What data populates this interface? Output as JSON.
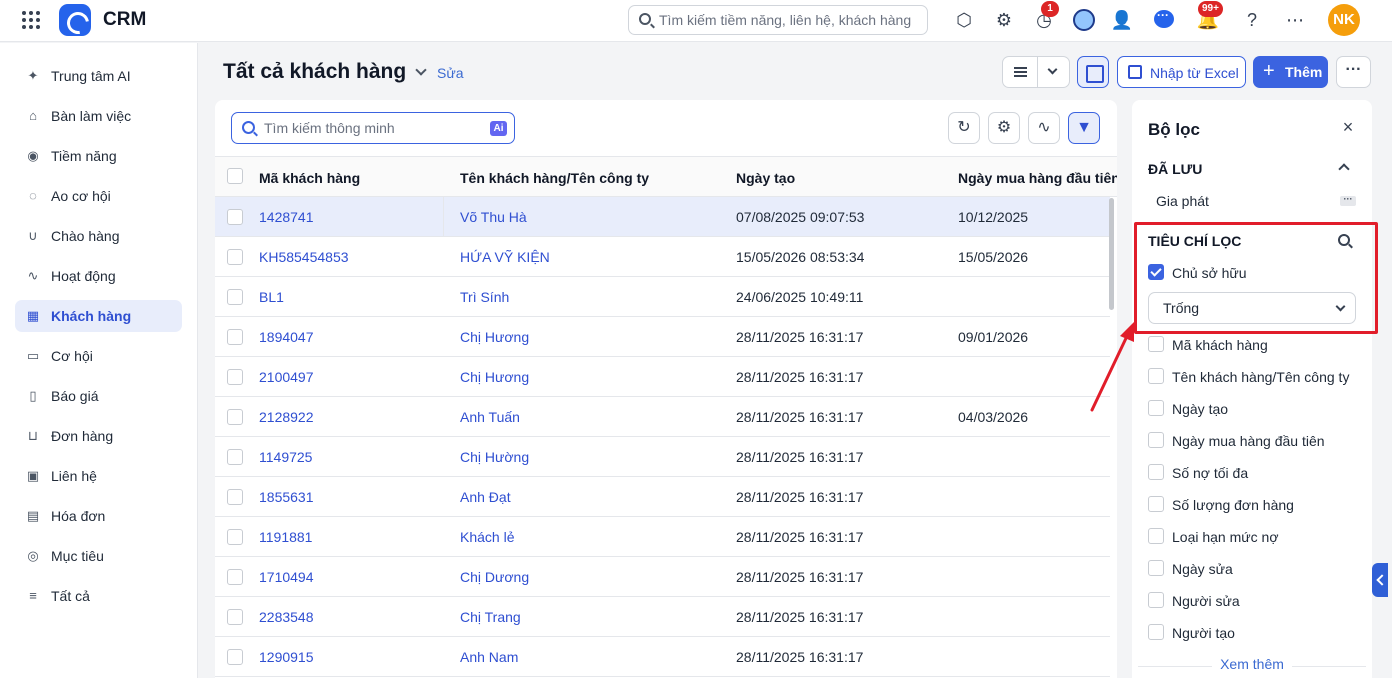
{
  "app": {
    "title": "CRM"
  },
  "search": {
    "placeholder": "Tìm kiếm tiềm năng, liên hệ, khách hàng"
  },
  "topbar": {
    "timer_badge": "1",
    "bell_badge": "99+",
    "user_initials": "NK"
  },
  "sidebar": {
    "items": [
      {
        "label": "Trung tâm AI",
        "icon": "sparkle-icon"
      },
      {
        "label": "Bàn làm việc",
        "icon": "home-icon"
      },
      {
        "label": "Tiềm năng",
        "icon": "user-circle-icon"
      },
      {
        "label": "Ao cơ hội",
        "icon": "pond-icon"
      },
      {
        "label": "Chào hàng",
        "icon": "magnet-icon"
      },
      {
        "label": "Hoạt động",
        "icon": "activity-icon"
      },
      {
        "label": "Khách hàng",
        "icon": "building-icon",
        "active": true
      },
      {
        "label": "Cơ hội",
        "icon": "briefcase-icon"
      },
      {
        "label": "Báo giá",
        "icon": "quote-icon"
      },
      {
        "label": "Đơn hàng",
        "icon": "cart-icon"
      },
      {
        "label": "Liên hệ",
        "icon": "contact-icon"
      },
      {
        "label": "Hóa đơn",
        "icon": "invoice-icon"
      },
      {
        "label": "Mục tiêu",
        "icon": "target-icon"
      },
      {
        "label": "Tất cả",
        "icon": "menu-icon"
      }
    ]
  },
  "header": {
    "title": "Tất cả khách hàng",
    "edit_label": "Sửa",
    "import_label": "Nhập từ Excel",
    "add_label": "Thêm"
  },
  "table": {
    "smart_search_placeholder": "Tìm kiếm thông minh",
    "ai_badge": "Ai",
    "columns": [
      "Mã khách hàng",
      "Tên khách hàng/Tên công ty",
      "Ngày tạo",
      "Ngày mua hàng đầu tiên"
    ],
    "rows": [
      {
        "code": "1428741",
        "name": "Võ Thu Hà",
        "created": "07/08/2025 09:07:53",
        "first_purchase": "10/12/2025"
      },
      {
        "code": "KH585454853",
        "name": "HỨA VỸ KIỆN",
        "created": "15/05/2026 08:53:34",
        "first_purchase": "15/05/2026"
      },
      {
        "code": "BL1",
        "name": "Trì Sính",
        "created": "24/06/2025 10:49:11",
        "first_purchase": ""
      },
      {
        "code": "1894047",
        "name": "Chị Hương",
        "created": "28/11/2025 16:31:17",
        "first_purchase": "09/01/2026"
      },
      {
        "code": "2100497",
        "name": "Chị Hương",
        "created": "28/11/2025 16:31:17",
        "first_purchase": ""
      },
      {
        "code": "2128922",
        "name": "Anh Tuấn",
        "created": "28/11/2025 16:31:17",
        "first_purchase": "04/03/2026"
      },
      {
        "code": "1149725",
        "name": "Chị Hường",
        "created": "28/11/2025 16:31:17",
        "first_purchase": ""
      },
      {
        "code": "1855631",
        "name": "Anh Đạt",
        "created": "28/11/2025 16:31:17",
        "first_purchase": ""
      },
      {
        "code": "1191881",
        "name": "Khách lẻ",
        "created": "28/11/2025 16:31:17",
        "first_purchase": ""
      },
      {
        "code": "1710494",
        "name": "Chị Dương",
        "created": "28/11/2025 16:31:17",
        "first_purchase": ""
      },
      {
        "code": "2283548",
        "name": "Chị Trang",
        "created": "28/11/2025 16:31:17",
        "first_purchase": ""
      },
      {
        "code": "1290915",
        "name": "Anh Nam",
        "created": "28/11/2025 16:31:17",
        "first_purchase": ""
      }
    ]
  },
  "filter": {
    "title": "Bộ lọc",
    "saved_heading": "ĐÃ LƯU",
    "saved_items": [
      "Gia phát"
    ],
    "criteria_heading": "TIÊU CHÍ LỌC",
    "owner_label": "Chủ sở hữu",
    "owner_value": "Trống",
    "criteria": [
      "Mã khách hàng",
      "Tên khách hàng/Tên công ty",
      "Ngày tạo",
      "Ngày mua hàng đầu tiên",
      "Số nợ tối đa",
      "Số lượng đơn hàng",
      "Loại hạn mức nợ",
      "Ngày sửa",
      "Người sửa",
      "Người tạo"
    ],
    "more_label": "Xem thêm"
  },
  "colors": {
    "accent": "#3b63e0",
    "link": "#2f4fd1",
    "annotation": "#e11d2a"
  }
}
